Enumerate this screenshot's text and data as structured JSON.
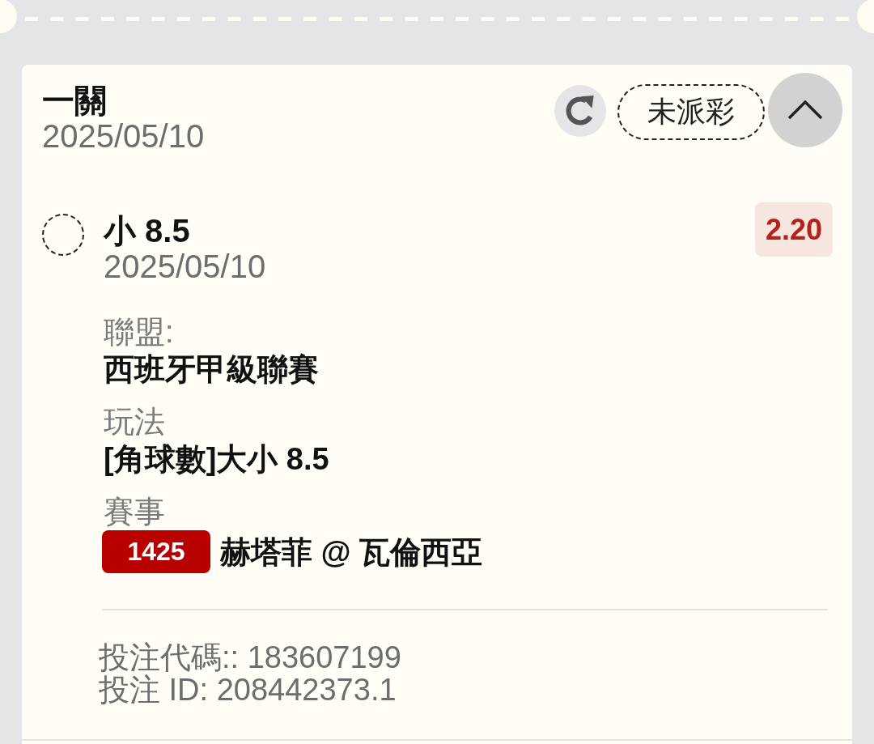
{
  "ticket": {
    "title": "一關",
    "date": "2025/05/10",
    "status": "未派彩",
    "expanded": true
  },
  "selection": {
    "name": "小 8.5",
    "date": "2025/05/10",
    "odds": "2.20"
  },
  "details": [
    {
      "kind": "text",
      "label": "聯盟:",
      "value": "西班牙甲級聯賽"
    },
    {
      "kind": "text",
      "label": "玩法",
      "value": "[角球數]大小 8.5"
    },
    {
      "kind": "match",
      "label": "賽事",
      "badge": "1425",
      "value": "赫塔菲 @ 瓦倫西亞"
    }
  ],
  "references": [
    "投注代碼:: 183607199",
    "投注 ID: 208442373.1"
  ]
}
